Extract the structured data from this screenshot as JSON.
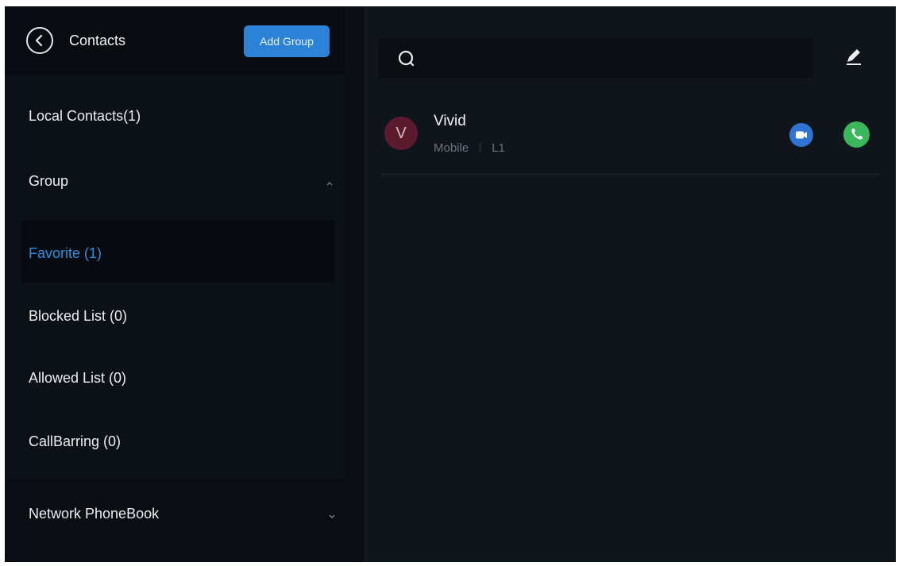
{
  "header": {
    "title": "Contacts",
    "add_group_label": "Add Group"
  },
  "sidebar": {
    "local_contacts": "Local Contacts(1)",
    "group_label": "Group",
    "groups": [
      {
        "label": "Favorite  (1)",
        "selected": true
      },
      {
        "label": "Blocked List  (0)",
        "selected": false
      },
      {
        "label": "Allowed List  (0)",
        "selected": false
      },
      {
        "label": "CallBarring  (0)",
        "selected": false
      }
    ],
    "network_phonebook": "Network PhoneBook"
  },
  "search": {
    "placeholder": ""
  },
  "contacts": [
    {
      "initial": "V",
      "name": "Vivid",
      "type": "Mobile",
      "line": "L1"
    }
  ],
  "colors": {
    "accent": "#2c82d6",
    "selected_text": "#2f8fe0",
    "video_button": "#2f74d0",
    "call_button": "#3ab75a",
    "avatar_bg": "#5c1a2e"
  },
  "icons": [
    "back-icon",
    "search-icon",
    "edit-icon",
    "chevron-up-icon",
    "chevron-down-icon",
    "video-call-icon",
    "phone-icon"
  ]
}
